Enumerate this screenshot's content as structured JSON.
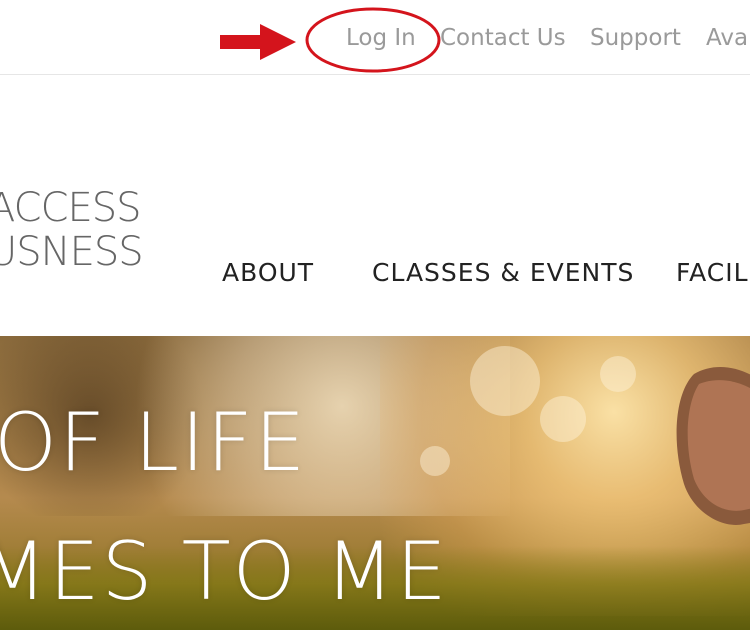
{
  "top_links": [
    {
      "id": "login",
      "label": "Log In"
    },
    {
      "id": "contact",
      "label": "Contact Us"
    },
    {
      "id": "support",
      "label": "Support"
    },
    {
      "id": "ava",
      "label": "Ava"
    }
  ],
  "annotation": {
    "color": "#d4141c",
    "arrow_icon": "arrow-right-icon",
    "ellipse_icon": "highlight-ellipse"
  },
  "logo": {
    "line1": "ACCESS",
    "line2": "USNESS"
  },
  "nav": [
    {
      "id": "about",
      "label": "ABOUT"
    },
    {
      "id": "classes",
      "label": "CLASSES & EVENTS"
    },
    {
      "id": "facil",
      "label": "FACIL"
    }
  ],
  "hero": {
    "line1": "OF LIFE",
    "line2": "MES TO ME"
  }
}
